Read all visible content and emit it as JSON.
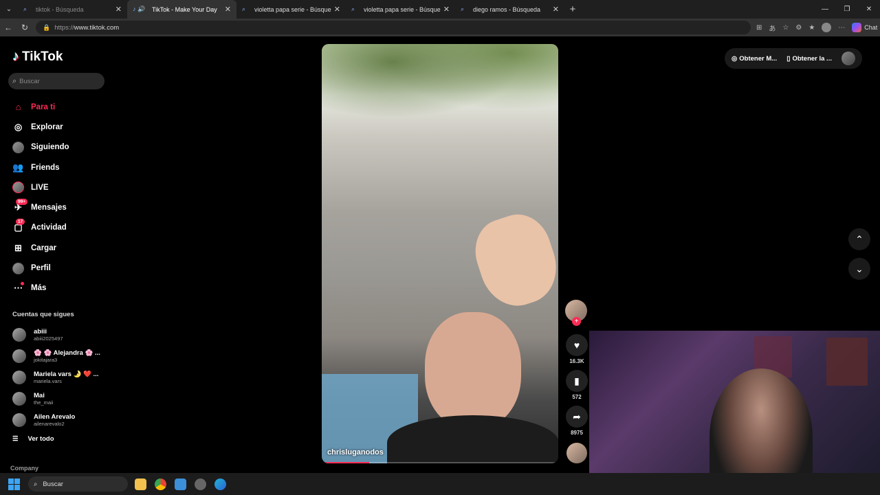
{
  "browser": {
    "tabs": [
      {
        "label": "tiktok - Búsqueda",
        "active": false,
        "dim": true
      },
      {
        "label": "TikTok - Make Your Day",
        "active": true,
        "dim": false
      },
      {
        "label": "violetta papa serie - Búsqueda",
        "active": false,
        "dim": false
      },
      {
        "label": "violetta papa serie - Búsqueda Imá",
        "active": false,
        "dim": false
      },
      {
        "label": "diego ramos - Búsqueda",
        "active": false,
        "dim": false
      }
    ],
    "url_proto": "https://",
    "url_host": "www.tiktok.com",
    "chat_label": "Chat"
  },
  "tiktok": {
    "logo": "TikTok",
    "search_placeholder": "Buscar",
    "menu": [
      {
        "label": "Para ti",
        "icon": "home-icon",
        "active": true
      },
      {
        "label": "Explorar",
        "icon": "compass-icon",
        "active": false
      },
      {
        "label": "Siguiendo",
        "icon": "following-avatar-icon",
        "active": false
      },
      {
        "label": "Friends",
        "icon": "friends-icon",
        "active": false
      },
      {
        "label": "LIVE",
        "icon": "live-avatar-icon",
        "active": false
      },
      {
        "label": "Mensajes",
        "icon": "messages-icon",
        "active": false,
        "badge": "99+"
      },
      {
        "label": "Actividad",
        "icon": "activity-icon",
        "active": false,
        "badge": "17"
      },
      {
        "label": "Cargar",
        "icon": "upload-icon",
        "active": false
      },
      {
        "label": "Perfil",
        "icon": "profile-avatar-icon",
        "active": false
      },
      {
        "label": "Más",
        "icon": "more-icon",
        "active": false
      }
    ],
    "following_title": "Cuentas que sigues",
    "following": [
      {
        "name": "abiii",
        "handle": "abiii2025497"
      },
      {
        "name": "🌸 🌸 Alejandra 🌸 ...",
        "handle": "jokitajara3"
      },
      {
        "name": "Mariela vars 🌛 ❤️ ...",
        "handle": "mariela.vars"
      },
      {
        "name": "Mai",
        "handle": "the_maii"
      },
      {
        "name": "Ailen Arevalo",
        "handle": "ailenarevalo2"
      }
    ],
    "see_all": "Ver todo",
    "company": "Company",
    "video_author": "chrisluganodos",
    "video_progress": 0.2,
    "likes": "16.3K",
    "saves": "572",
    "shares": "8975",
    "top_right": {
      "coins": "Obtener M...",
      "app": "Obtener la ..."
    }
  },
  "taskbar": {
    "search_label": "Buscar"
  }
}
